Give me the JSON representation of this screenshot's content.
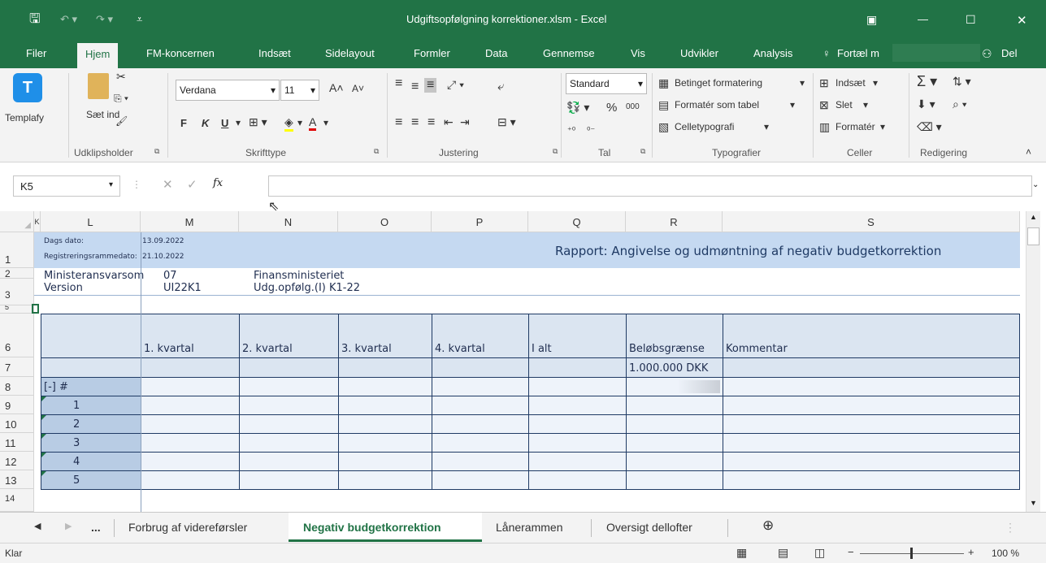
{
  "window": {
    "title": "Udgiftsopfølgning korrektioner.xlsm - Excel"
  },
  "quick_access": {
    "save_icon": "save-icon",
    "undo_icon": "undo-icon",
    "redo_icon": "redo-icon"
  },
  "ribbon_tabs": [
    "Filer",
    "Hjem",
    "FM-koncernen",
    "Indsæt",
    "Sidelayout",
    "Formler",
    "Data",
    "Gennemse",
    "Vis",
    "Udvikler",
    "Analysis"
  ],
  "tell_me": "Fortæl m",
  "share_label": "Del",
  "ribbon": {
    "templafy": "Templafy",
    "paste": "Sæt ind",
    "clipboard_group": "Udklipsholder",
    "font_name": "Verdana",
    "font_size": "11",
    "bold": "F",
    "italic": "K",
    "underline": "U",
    "font_group": "Skrifttype",
    "align_group": "Justering",
    "number_format": "Standard",
    "percent": "%",
    "thousands": "000",
    "number_group": "Tal",
    "cond_format": "Betinget formatering",
    "format_table": "Formatér som tabel",
    "cell_styles": "Celletypografi",
    "styles_group": "Typografier",
    "insert": "Indsæt",
    "delete": "Slet",
    "format": "Formatér",
    "cells_group": "Celler",
    "editing_group": "Redigering"
  },
  "formula_bar": {
    "name_box": "K5",
    "fx": "fx",
    "formula": ""
  },
  "columns": [
    "K",
    "L",
    "M",
    "N",
    "O",
    "P",
    "Q",
    "R",
    "S"
  ],
  "rows": [
    "1",
    "2",
    "3",
    "5",
    "6",
    "7",
    "8",
    "9",
    "10",
    "11",
    "12",
    "13",
    "14"
  ],
  "sheet": {
    "dags_dato_label": "Dags dato:",
    "dags_dato": "13.09.2022",
    "reg_label": "Registreringsrammedato:",
    "reg_dato": "21.10.2022",
    "report_title": "Rapport: Angivelse og udmøntning af negativ budgetkorrektion",
    "r2_label": "Ministeransvarsom",
    "r2_code": "07",
    "r2_name": "Finansministeriet",
    "r3_label": "Version",
    "r3_code": "UI22K1",
    "r3_name": "Udg.opfølg.(I) K1-22",
    "headers": [
      "1. kvartal",
      "2. kvartal",
      "3. kvartal",
      "4. kvartal",
      "I alt",
      "Beløbsgrænse",
      "Kommentar"
    ],
    "limit": "1.000.000 DKK",
    "group_label": "[-] #",
    "item_numbers": [
      "1",
      "2",
      "3",
      "4",
      "5"
    ]
  },
  "sheet_tabs": {
    "more": "...",
    "tabs": [
      "Forbrug af videreførsler",
      "Negativ budgetkorrektion",
      "Lånerammen",
      "Oversigt dellofter"
    ],
    "active": "Negativ budgetkorrektion"
  },
  "status": {
    "mode": "Klar",
    "zoom": "100 %"
  }
}
